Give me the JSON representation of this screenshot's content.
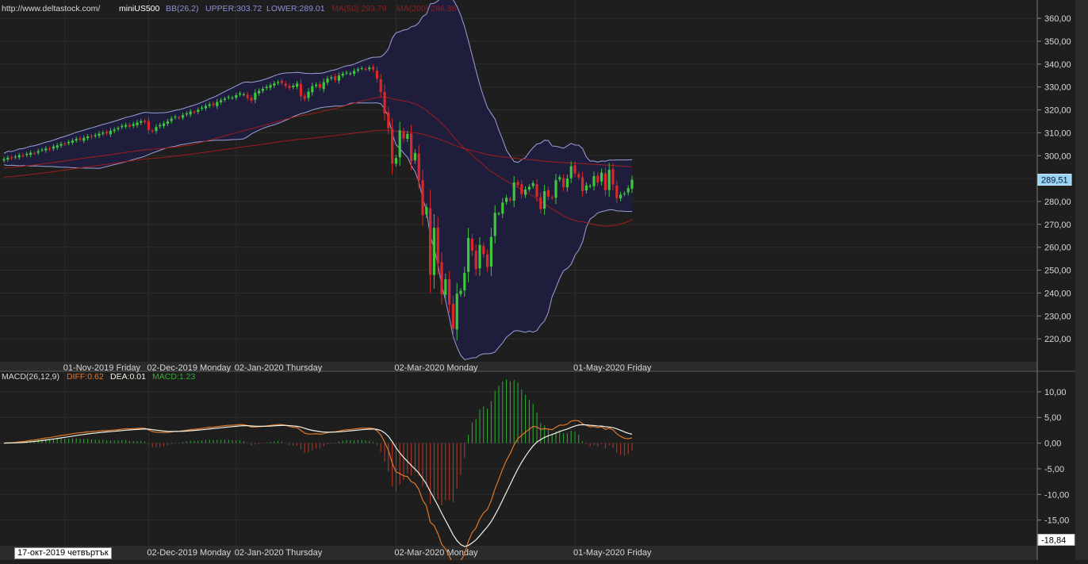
{
  "source_url": "http://www.deltastock.com/",
  "symbol": "miniUS500",
  "indicators": {
    "bb": "BB(26,2)",
    "upper": "UPPER:303.72",
    "lower": "LOWER:289.01",
    "ma50": "MA(50)  293.79",
    "ma200": "MA(200)  286.36"
  },
  "macd_header": {
    "name": "MACD(26,12,9)",
    "diff": "DIFF:0.62",
    "dea": "DEA:0.01",
    "macd": "MACD:1.23"
  },
  "last_price_label": "289,51",
  "macd_last_label": "-18,84",
  "cursor_date": "17-окт-2019 четвъртък",
  "colors": {
    "background": "#1e1e1e",
    "up": "#3ec63e",
    "down": "#d62a2a",
    "band_fill": "#1e1e3c",
    "band_line": "#9aa0d8",
    "ma": "#a01c1c",
    "diff": "#e0782a",
    "dea": "#f2f2e6",
    "macd_pos": "#2fae2f",
    "macd_neg": "#b53a2a"
  },
  "chart_data": [
    {
      "type": "candlestick",
      "symbol": "miniUS500",
      "ylim": [
        210,
        368
      ],
      "y_ticks": [
        "220,00",
        "230,00",
        "240,00",
        "250,00",
        "260,00",
        "270,00",
        "280,00",
        "290,00",
        "300,00",
        "310,00",
        "320,00",
        "330,00",
        "340,00",
        "350,00",
        "360,00"
      ],
      "x_labels": [
        "01-Nov-2019 Friday",
        "02-Dec-2019 Monday",
        "02-Jan-2020 Thursday",
        "02-Mar-2020 Monday",
        "01-May-2020 Friday"
      ],
      "close": [
        298.5,
        299.1,
        298.9,
        299.6,
        300.2,
        300.0,
        300.8,
        301.3,
        301.1,
        302.0,
        302.6,
        303.1,
        302.8,
        304.0,
        304.5,
        305.1,
        305.0,
        306.0,
        306.6,
        307.3,
        307.0,
        307.8,
        308.4,
        308.1,
        309.0,
        309.6,
        310.1,
        309.8,
        310.9,
        311.4,
        312.0,
        313.0,
        313.4,
        312.7,
        313.8,
        314.5,
        315.1,
        314.7,
        311.2,
        310.8,
        312.5,
        313.4,
        314.1,
        315.0,
        316.2,
        317.0,
        316.6,
        317.7,
        318.5,
        319.3,
        319.0,
        320.1,
        321.0,
        321.7,
        322.4,
        322.1,
        323.5,
        324.2,
        324.9,
        325.6,
        325.3,
        326.4,
        327.2,
        326.8,
        325.2,
        324.0,
        327.5,
        328.3,
        329.2,
        330.1,
        330.8,
        331.6,
        332.2,
        331.8,
        330.5,
        329.6,
        330.6,
        331.5,
        326.0,
        324.8,
        328.0,
        330.4,
        331.0,
        329.6,
        332.1,
        333.6,
        334.2,
        333.1,
        335.0,
        335.8,
        336.3,
        335.9,
        337.0,
        337.7,
        338.2,
        337.8,
        338.5,
        337.6,
        333.6,
        327.7,
        318.5,
        312.0,
        296.5,
        299.0,
        311.1,
        307.5,
        309.5,
        297.5,
        301.2,
        289.3,
        274.0,
        277.5,
        248.0,
        268.5,
        253.0,
        239.5,
        246.0,
        235.0,
        224.5,
        239.7,
        241.0,
        248.8,
        264.0,
        258.4,
        250.5,
        261.0,
        257.0,
        251.4,
        264.5,
        275.0,
        274.7,
        279.5,
        281.6,
        280.5,
        288.3,
        287.1,
        283.2,
        285.2,
        286.4,
        288.0,
        282.0,
        276.7,
        284.5,
        282.1,
        281.6,
        289.3,
        290.6,
        286.3,
        290.0,
        295.4,
        292.2,
        290.6,
        284.5,
        287.0,
        286.8,
        291.1,
        288.3,
        292.6,
        285.0,
        293.8,
        287.4,
        281.5,
        283.0,
        283.5,
        285.8,
        289.5
      ],
      "last_price": 289.51,
      "bollinger_upper_last": 303.72,
      "bollinger_lower_last": 289.01,
      "ma50_last": 293.79,
      "ma200_last": 286.36
    },
    {
      "type": "macd",
      "name": "MACD(26,12,9)",
      "ylim": [
        -20,
        14
      ],
      "y_ticks": [
        "-15,00",
        "-10,00",
        "-5,00",
        "0,00",
        "5,00",
        "10,00"
      ],
      "x_labels": [
        "02-Dec-2019 Monday",
        "02-Jan-2020 Thursday",
        "02-Mar-2020 Monday",
        "01-May-2020 Friday"
      ],
      "diff": 0.62,
      "dea": 0.01,
      "macd": 1.23,
      "last_label": -18.84
    }
  ]
}
